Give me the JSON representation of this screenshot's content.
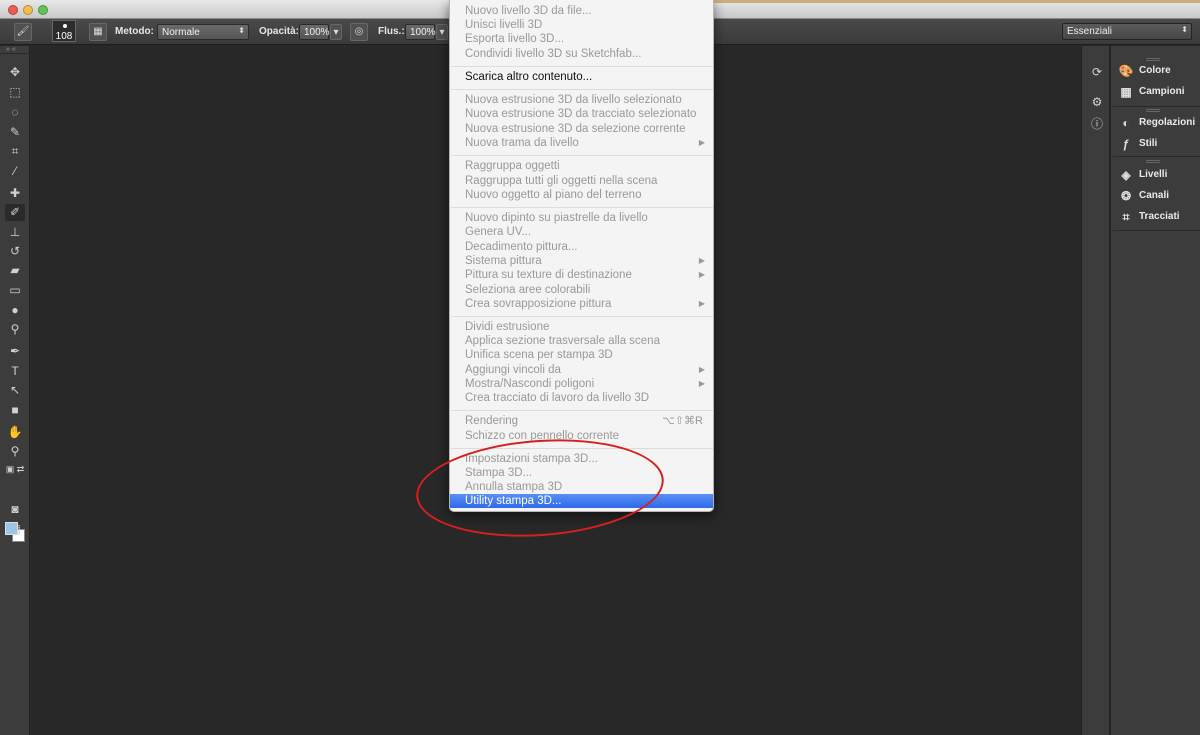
{
  "options_bar": {
    "brush_size": "108",
    "method_label": "Metodo:",
    "method_value": "Normale",
    "opacity_label": "Opacità:",
    "opacity_value": "100%",
    "flow_label": "Flus.:",
    "flow_value": "100%"
  },
  "workspace": {
    "value": "Essenziali"
  },
  "menu": {
    "items": [
      {
        "label": "Nuovo livello 3D da file...",
        "enabled": false
      },
      {
        "label": "Unisci livelli 3D",
        "enabled": false
      },
      {
        "label": "Esporta livello 3D...",
        "enabled": false
      },
      {
        "label": "Condividi livello 3D su Sketchfab...",
        "enabled": false
      },
      {
        "label": "Scarica altro contenuto...",
        "enabled": true
      },
      {
        "label": "Nuova estrusione 3D da livello selezionato",
        "enabled": false
      },
      {
        "label": "Nuova estrusione 3D da tracciato selezionato",
        "enabled": false
      },
      {
        "label": "Nuova estrusione 3D da selezione corrente",
        "enabled": false
      },
      {
        "label": "Nuova trama da livello",
        "enabled": false,
        "submenu": true
      },
      {
        "label": "Raggruppa oggetti",
        "enabled": false
      },
      {
        "label": "Raggruppa tutti gli oggetti nella scena",
        "enabled": false
      },
      {
        "label": "Nuovo oggetto al piano del terreno",
        "enabled": false
      },
      {
        "label": "Nuovo dipinto su piastrelle da livello",
        "enabled": false
      },
      {
        "label": "Genera UV...",
        "enabled": false
      },
      {
        "label": "Decadimento pittura...",
        "enabled": false
      },
      {
        "label": "Sistema pittura",
        "enabled": false,
        "submenu": true
      },
      {
        "label": "Pittura su texture di destinazione",
        "enabled": false,
        "submenu": true
      },
      {
        "label": "Seleziona aree colorabili",
        "enabled": false
      },
      {
        "label": "Crea sovrapposizione pittura",
        "enabled": false,
        "submenu": true
      },
      {
        "label": "Dividi estrusione",
        "enabled": false
      },
      {
        "label": "Applica sezione trasversale alla scena",
        "enabled": false
      },
      {
        "label": "Unifica scena per stampa 3D",
        "enabled": false
      },
      {
        "label": "Aggiungi vincoli da",
        "enabled": false,
        "submenu": true
      },
      {
        "label": "Mostra/Nascondi poligoni",
        "enabled": false,
        "submenu": true
      },
      {
        "label": "Crea tracciato di lavoro da livello 3D",
        "enabled": false
      },
      {
        "label": "Rendering",
        "enabled": false,
        "shortcut": "⌥⇧⌘R"
      },
      {
        "label": "Schizzo con pennello corrente",
        "enabled": false
      },
      {
        "label": "Impostazioni stampa 3D...",
        "enabled": false
      },
      {
        "label": "Stampa 3D...",
        "enabled": false
      },
      {
        "label": "Annulla stampa 3D",
        "enabled": false
      },
      {
        "label": "Utility stampa 3D...",
        "enabled": true,
        "highlighted": true
      }
    ],
    "submenu_glyph": "▶"
  },
  "panels": {
    "items": [
      "Colore",
      "Campioni",
      "Regolazioni",
      "Stili",
      "Livelli",
      "Canali",
      "Tracciati"
    ]
  },
  "colors": {
    "foreground": "#9cc6e8",
    "background": "#ffffff",
    "highlight": "#2f6ae8",
    "annotation": "#d62020"
  }
}
